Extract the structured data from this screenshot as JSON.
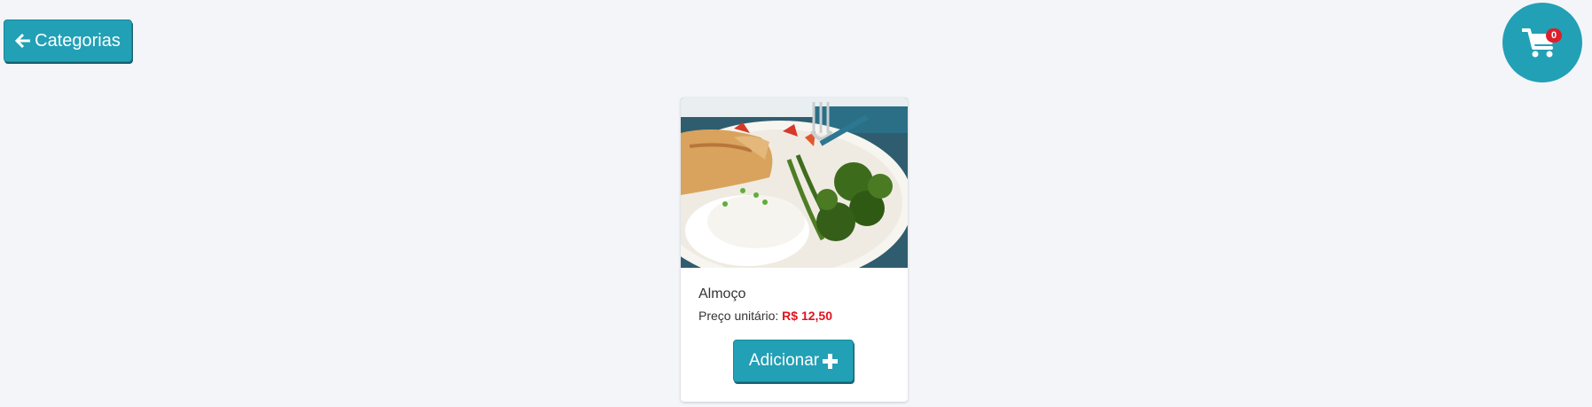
{
  "header": {
    "back_button": {
      "label": "Categorias",
      "icon": "arrow-left-icon"
    },
    "cart": {
      "icon": "shopping-cart-icon",
      "badge_count": "0"
    }
  },
  "product": {
    "image": "food-plate-image",
    "name": "Almoço",
    "price_label": "Preço unitário:",
    "price_value": "R$ 12,50",
    "add_button": {
      "label": "Adicionar",
      "icon": "plus-icon"
    }
  },
  "colors": {
    "accent": "#22a0b6",
    "price": "#e0121f",
    "badge": "#dc1f2b",
    "background": "#f4f5f9"
  }
}
